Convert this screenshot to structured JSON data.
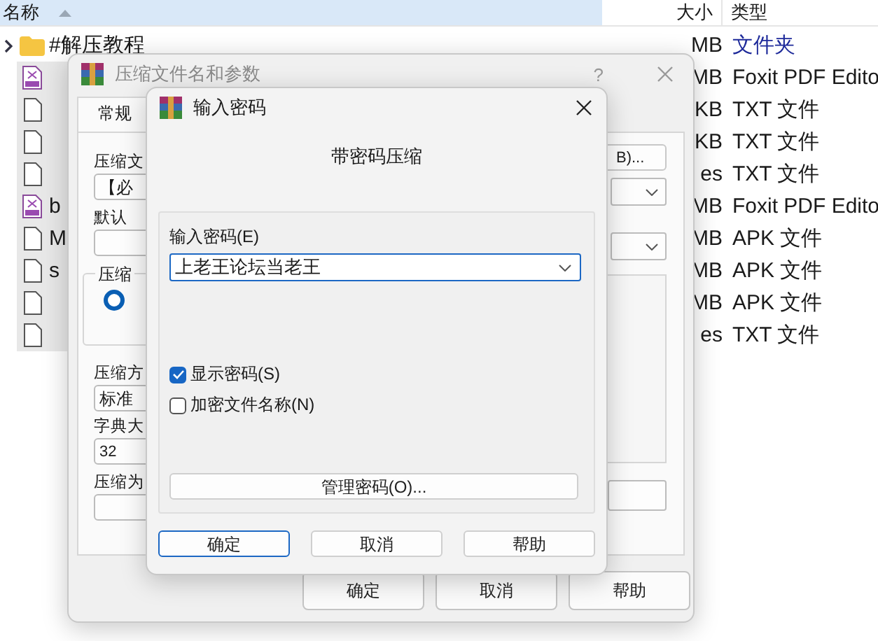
{
  "explorer": {
    "columns": [
      {
        "label": "名称",
        "sorted": true
      },
      {
        "label": "大小",
        "sorted": false
      },
      {
        "label": "类型",
        "sorted": false
      }
    ],
    "rows": [
      {
        "kind": "folder",
        "name": "#解压教程",
        "size": "MB",
        "type": "文件夹"
      },
      {
        "kind": "pdf",
        "size": "MB",
        "type": "Foxit PDF Edito"
      },
      {
        "kind": "file",
        "size": "KB",
        "type": "TXT 文件"
      },
      {
        "kind": "file",
        "size": "KB",
        "type": "TXT 文件"
      },
      {
        "kind": "file",
        "size": "es",
        "type": "TXT 文件"
      },
      {
        "kind": "pdf",
        "name": "b",
        "size": "MB",
        "type": "Foxit PDF Edito"
      },
      {
        "kind": "file",
        "name": "M",
        "size": "MB",
        "type": "APK 文件"
      },
      {
        "kind": "file",
        "name": "s",
        "size": "MB",
        "type": "APK 文件"
      },
      {
        "kind": "file",
        "size": "MB",
        "type": "APK 文件"
      },
      {
        "kind": "file",
        "size": "es",
        "type": "TXT 文件"
      }
    ]
  },
  "archive_dialog": {
    "title": "压缩文件名和参数",
    "help": "?",
    "tabs": [
      {
        "label": "常规",
        "selected": true
      }
    ],
    "archive_name_label": "压缩文",
    "archive_name_value": "【必",
    "browse_button": "B)...",
    "profile_label": "默认",
    "format_group_label": "压缩",
    "format_radio_selected": true,
    "method_label": "压缩方",
    "method_value": "标准",
    "dictionary_label": "字典大",
    "dictionary_value": "32",
    "split_label": "压缩为",
    "buttons": [
      "确定",
      "取消",
      "帮助"
    ]
  },
  "password_dialog": {
    "title": "输入密码",
    "heading": "带密码压缩",
    "password_label": "输入密码(E)",
    "password_value": "上老王论坛当老王",
    "options": [
      {
        "label": "显示密码(S)",
        "checked": true
      },
      {
        "label": "加密文件名称(N)",
        "checked": false
      }
    ],
    "manage_button": "管理密码(O)...",
    "buttons": [
      {
        "label": "确定",
        "default": true
      },
      {
        "label": "取消",
        "default": false
      },
      {
        "label": "帮助",
        "default": false
      }
    ]
  }
}
